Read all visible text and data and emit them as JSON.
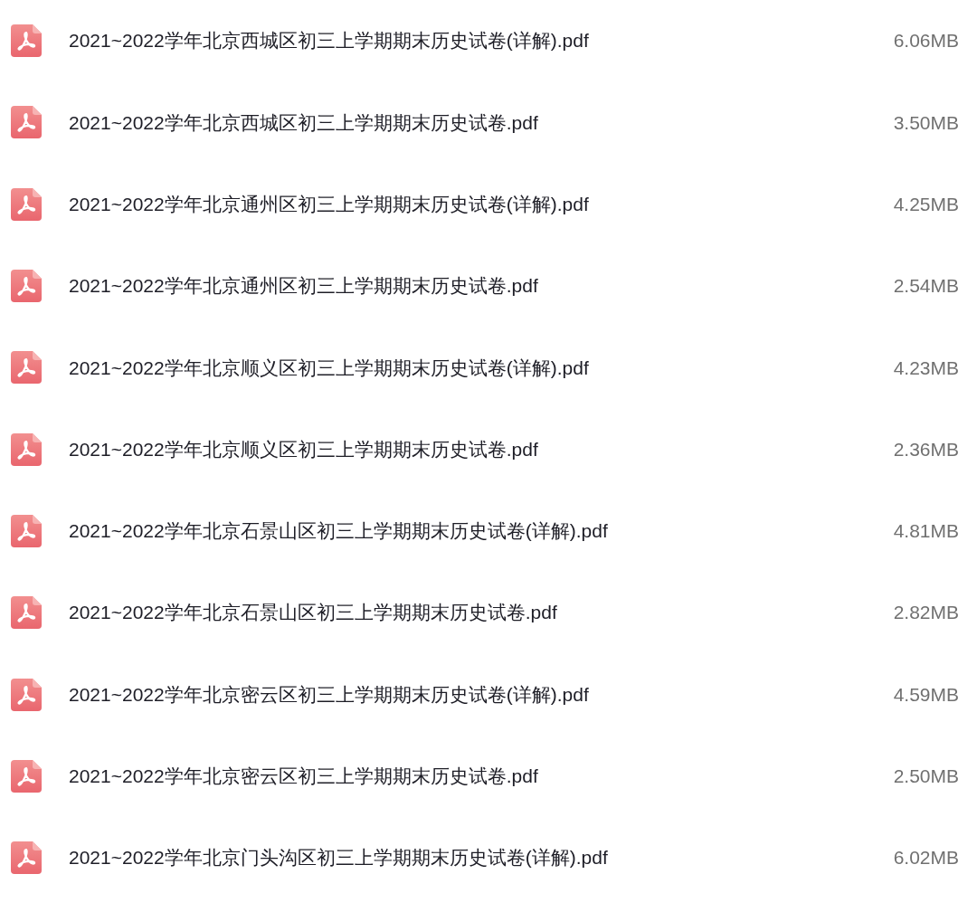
{
  "files": [
    {
      "name": "2021~2022学年北京西城区初三上学期期末历史试卷(详解).pdf",
      "size": "6.06MB"
    },
    {
      "name": "2021~2022学年北京西城区初三上学期期末历史试卷.pdf",
      "size": "3.50MB"
    },
    {
      "name": "2021~2022学年北京通州区初三上学期期末历史试卷(详解).pdf",
      "size": "4.25MB"
    },
    {
      "name": "2021~2022学年北京通州区初三上学期期末历史试卷.pdf",
      "size": "2.54MB"
    },
    {
      "name": "2021~2022学年北京顺义区初三上学期期末历史试卷(详解).pdf",
      "size": "4.23MB"
    },
    {
      "name": "2021~2022学年北京顺义区初三上学期期末历史试卷.pdf",
      "size": "2.36MB"
    },
    {
      "name": "2021~2022学年北京石景山区初三上学期期末历史试卷(详解).pdf",
      "size": "4.81MB"
    },
    {
      "name": "2021~2022学年北京石景山区初三上学期期末历史试卷.pdf",
      "size": "2.82MB"
    },
    {
      "name": "2021~2022学年北京密云区初三上学期期末历史试卷(详解).pdf",
      "size": "4.59MB"
    },
    {
      "name": "2021~2022学年北京密云区初三上学期期末历史试卷.pdf",
      "size": "2.50MB"
    },
    {
      "name": "2021~2022学年北京门头沟区初三上学期期末历史试卷(详解).pdf",
      "size": "6.02MB"
    }
  ]
}
